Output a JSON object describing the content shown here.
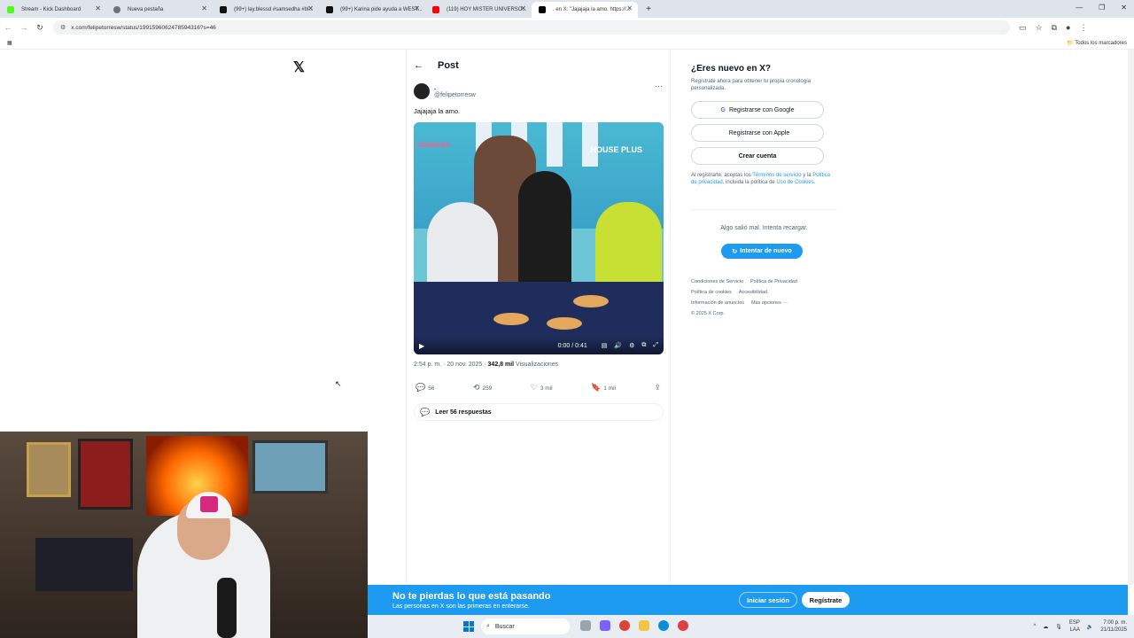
{
  "browser": {
    "tabs": [
      {
        "label": "Stream - Kick Dashboard",
        "color": "#53fc18",
        "active": false
      },
      {
        "label": "Nueva pestaña",
        "color": "#6b7280",
        "active": false
      },
      {
        "label": "(99+) lay.blessd #samsedha #bl...",
        "color": "#111111",
        "active": false
      },
      {
        "label": "(99+) Karina pide ayuda a WEST...",
        "color": "#111111",
        "active": false
      },
      {
        "label": "(119) HOY MISTER UNIVERSO...",
        "color": "#ff0000",
        "active": false
      },
      {
        "label": ". en X: \"Jajajaja la amo. https://...",
        "color": "#000000",
        "active": true
      }
    ],
    "new_tab": "+",
    "url": "x.com/felipetorresw/status/1991596062478594316?s=46",
    "bookmarks_label": "Todos los marcadores"
  },
  "x": {
    "logo": "𝕏",
    "header": {
      "back": "←",
      "title": "Post"
    },
    "tweet": {
      "name": ".",
      "handle": "@felipetorresw",
      "more": "···",
      "text": "Jajajaja la amo.",
      "video": {
        "time": "0:00 / 0:41",
        "logo_left": "cinamón",
        "logo_right": "HOUSE PLUS"
      },
      "timestamp": "2:54 p. m. · 20 nov. 2025 · ",
      "views": "342,8 mil",
      "views_label": " Visualizaciones",
      "replies": "56",
      "reposts": "259",
      "likes": "3 mil",
      "bookmarks": "1 mil",
      "read_replies": "Leer 56 respuestas"
    },
    "sidebar": {
      "title": "¿Eres nuevo en X?",
      "subtitle": "Regístrate ahora para obtener tu propia cronología personalizada.",
      "google": "Registrarse con Google",
      "apple": "Registrarse con Apple",
      "create": "Crear cuenta",
      "terms_a": "Al registrarte, aceptas los ",
      "terms_link1": "Términos de servicio",
      "terms_b": " y la ",
      "terms_link2": "Política de privacidad",
      "terms_c": ", incluida la política de ",
      "terms_link3": "Uso de Cookies",
      "terms_d": ".",
      "error": "Algo salió mal. Intenta recargar.",
      "retry": "Intentar de nuevo",
      "footer": [
        "Condiciones de Servicio",
        "Política de Privacidad",
        "Política de cookies",
        "Accesibilidad",
        "Información de anuncios",
        "Más opciones ···",
        "© 2025 X Corp."
      ]
    },
    "banner": {
      "title": "No te pierdas lo que está pasando",
      "subtitle": "Las personas en X son las primeras en enterarse.",
      "login": "Iniciar sesión",
      "register": "Regístrate"
    }
  },
  "taskbar": {
    "search": "Buscar",
    "lang": "ESP",
    "lang2": "LAA",
    "time": "7:00 p. m.",
    "date": "21/11/2025"
  }
}
